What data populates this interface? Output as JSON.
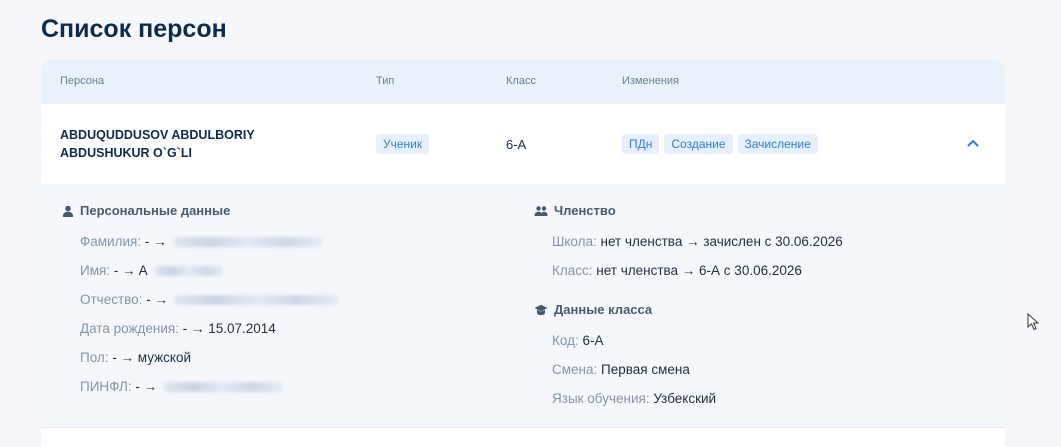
{
  "page": {
    "title": "Список персон"
  },
  "table": {
    "columns": [
      "Персона",
      "Тип",
      "Класс",
      "Изменения"
    ],
    "row": {
      "name_line1": "ABDUQUDDUSOV ABDULBORIY",
      "name_line2": "ABDUSHUKUR O`G`LI",
      "type": "Ученик",
      "class": "6-A",
      "changes": [
        "ПДн",
        "Создание",
        "Зачисление"
      ]
    }
  },
  "details": {
    "personal": {
      "title": "Персональные данные",
      "fields": [
        {
          "label": "Фамилия:",
          "value": "- →",
          "masked": true
        },
        {
          "label": "Имя:",
          "value": "- → A",
          "masked": true
        },
        {
          "label": "Отчество:",
          "value": "- →",
          "masked": true
        },
        {
          "label": "Дата рождения:",
          "value": "- → 15.07.2014",
          "masked": false
        },
        {
          "label": "Пол:",
          "value": "- → мужской",
          "masked": false
        },
        {
          "label": "ПИНФЛ:",
          "value": "- →",
          "masked": true
        }
      ]
    },
    "membership": {
      "title": "Членство",
      "fields": [
        {
          "label": "Школа:",
          "value": "нет членства → зачислен с 30.06.2026"
        },
        {
          "label": "Класс:",
          "value": "нет членства → 6-А с 30.06.2026"
        }
      ]
    },
    "class_data": {
      "title": "Данные класса",
      "fields": [
        {
          "label": "Код:",
          "value": "6-A"
        },
        {
          "label": "Смена:",
          "value": "Первая смена"
        },
        {
          "label": "Язык обучения:",
          "value": "Узбекский"
        }
      ]
    }
  },
  "colors": {
    "accent": "#2f7ed8",
    "title": "#0c2c4f",
    "header_bg": "#e9f1fb",
    "details_bg": "#f4f8fd"
  },
  "icons": [
    "person-icon",
    "group-icon",
    "graduation-cap-icon",
    "chevron-up-icon",
    "mouse-cursor-icon"
  ]
}
